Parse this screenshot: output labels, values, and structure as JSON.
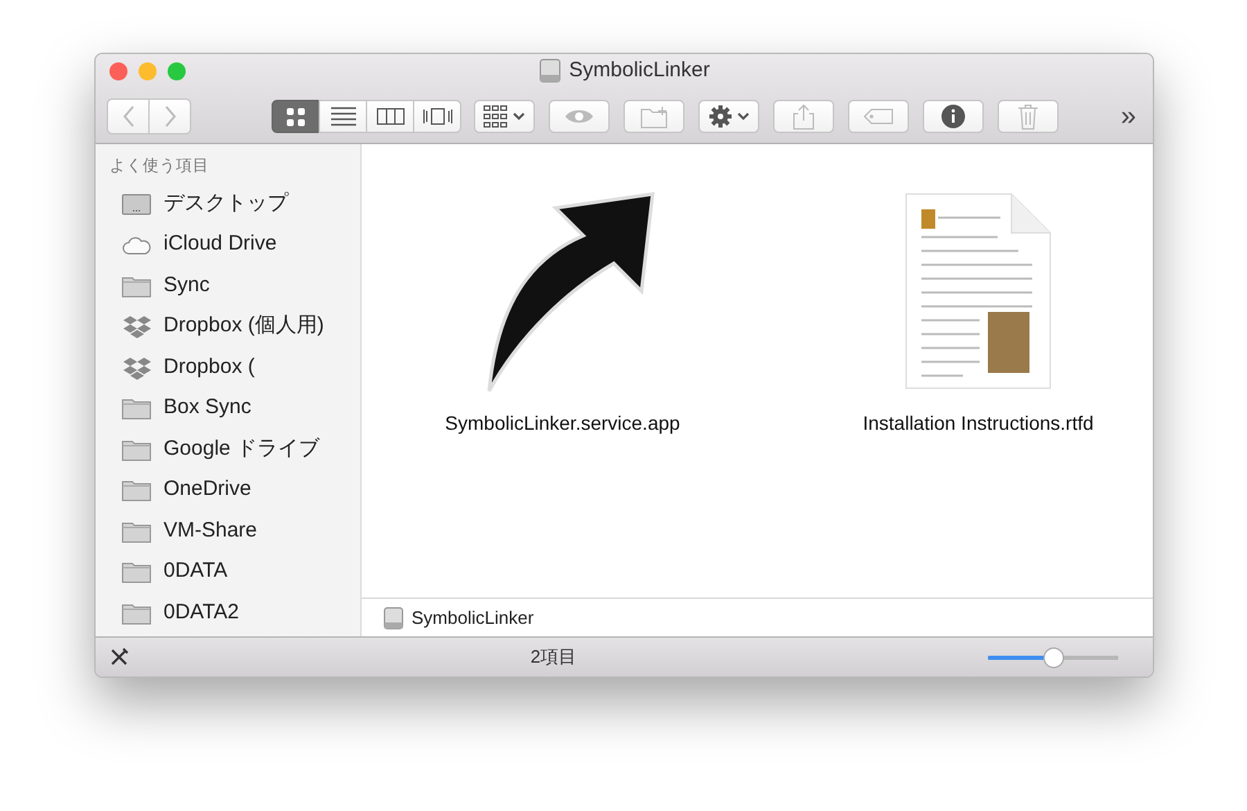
{
  "window": {
    "title": "SymbolicLinker"
  },
  "toolbar": {
    "nav": [
      {
        "kind": "back",
        "disabled": true
      },
      {
        "kind": "forward",
        "disabled": true
      }
    ],
    "views": [
      {
        "kind": "icon",
        "selected": true
      },
      {
        "kind": "list",
        "selected": false
      },
      {
        "kind": "column",
        "selected": false
      },
      {
        "kind": "coverflow",
        "selected": false
      }
    ],
    "buttons": [
      {
        "kind": "arrange",
        "disabled": false
      },
      {
        "kind": "quicklook",
        "disabled": true
      },
      {
        "kind": "newfolder",
        "disabled": true
      },
      {
        "kind": "action",
        "disabled": false
      },
      {
        "kind": "share",
        "disabled": true
      },
      {
        "kind": "tag",
        "disabled": true
      },
      {
        "kind": "info",
        "disabled": false
      },
      {
        "kind": "trash",
        "disabled": true
      }
    ],
    "overflow": "»"
  },
  "sidebar": {
    "heading": "よく使う項目",
    "items": [
      {
        "label": "デスクトップ",
        "kind": "desktop"
      },
      {
        "label": "iCloud Drive",
        "kind": "cloud"
      },
      {
        "label": "Sync",
        "kind": "folder"
      },
      {
        "label": "Dropbox (個人用)",
        "kind": "dropbox"
      },
      {
        "label": "Dropbox (",
        "kind": "dropbox"
      },
      {
        "label": "Box Sync",
        "kind": "folder"
      },
      {
        "label": "Google ドライブ",
        "kind": "folder"
      },
      {
        "label": "OneDrive",
        "kind": "folder"
      },
      {
        "label": "VM-Share",
        "kind": "folder"
      },
      {
        "label": "0DATA",
        "kind": "folder"
      },
      {
        "label": "0DATA2",
        "kind": "folder"
      }
    ]
  },
  "files": [
    {
      "name": "SymbolicLinker.service.app",
      "kind": "alias"
    },
    {
      "name": "Installation Instructions.rtfd",
      "kind": "document"
    }
  ],
  "path_bar": [
    {
      "label": "SymbolicLinker"
    }
  ],
  "status_bar": {
    "count": "2項目",
    "zoom": {
      "level": 0.5
    }
  }
}
